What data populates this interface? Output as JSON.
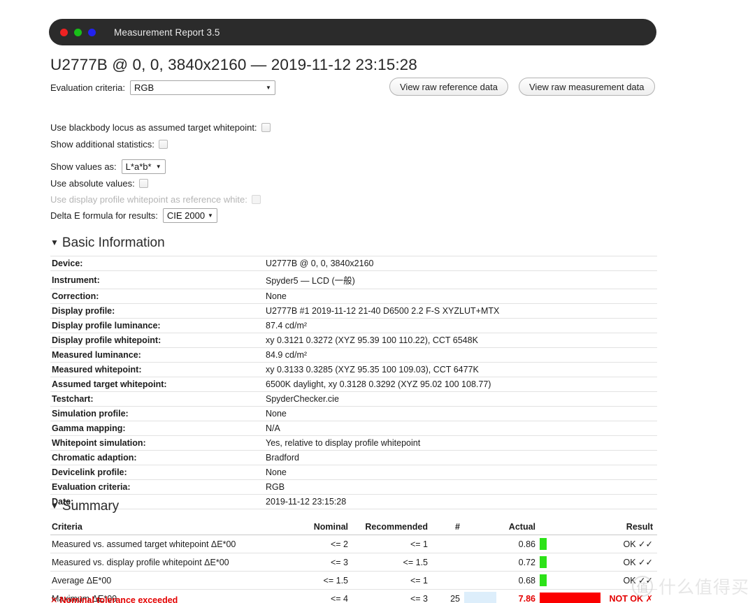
{
  "window": {
    "title": "Measurement Report 3.5",
    "dots": [
      "red",
      "green",
      "blue"
    ],
    "dot_colors": [
      "#ee2222",
      "#18c018",
      "#2222ee"
    ]
  },
  "page_title": "U2777B @ 0, 0, 3840x2160 — 2019-11-12 23:15:28",
  "controls": {
    "evaluation_criteria_label": "Evaluation criteria:",
    "evaluation_criteria_value": "RGB",
    "evaluation_criteria_options": [
      "RGB"
    ],
    "view_raw_reference_button": "View raw reference data",
    "view_raw_measurement_button": "View raw measurement data",
    "blackbody_label": "Use blackbody locus as assumed target whitepoint:",
    "blackbody_checked": false,
    "additional_stats_label": "Show additional statistics:",
    "additional_stats_checked": false,
    "show_values_as_label": "Show values as:",
    "show_values_as_value": "L*a*b*",
    "show_values_as_options": [
      "L*a*b*"
    ],
    "absolute_values_label": "Use absolute values:",
    "absolute_values_checked": false,
    "profile_whitepoint_label": "Use display profile whitepoint as reference white:",
    "profile_whitepoint_checked": false,
    "profile_whitepoint_disabled": true,
    "delta_e_label": "Delta E formula for results:",
    "delta_e_value": "CIE 2000",
    "delta_e_options": [
      "CIE 2000"
    ]
  },
  "basic_information": {
    "heading": "Basic Information",
    "rows": [
      {
        "key": "Device:",
        "value": "U2777B @ 0, 0, 3840x2160"
      },
      {
        "key": "Instrument:",
        "value": "Spyder5 — LCD (一般)"
      },
      {
        "key": "Correction:",
        "value": "None"
      },
      {
        "key": "Display profile:",
        "value": "U2777B #1 2019-11-12 21-40 D6500 2.2 F-S XYZLUT+MTX"
      },
      {
        "key": "Display profile luminance:",
        "value": "87.4 cd/m²"
      },
      {
        "key": "Display profile whitepoint:",
        "value": "xy 0.3121 0.3272 (XYZ 95.39 100 110.22), CCT 6548K"
      },
      {
        "key": "Measured luminance:",
        "value": "84.9 cd/m²"
      },
      {
        "key": "Measured whitepoint:",
        "value": "xy 0.3133 0.3285 (XYZ 95.35 100 109.03), CCT 6477K"
      },
      {
        "key": "Assumed target whitepoint:",
        "value": "6500K daylight, xy 0.3128 0.3292 (XYZ 95.02 100 108.77)"
      },
      {
        "key": "Testchart:",
        "value": "SpyderChecker.cie"
      },
      {
        "key": "Simulation profile:",
        "value": "None"
      },
      {
        "key": "Gamma mapping:",
        "value": "N/A"
      },
      {
        "key": "Whitepoint simulation:",
        "value": "Yes, relative to display profile whitepoint"
      },
      {
        "key": "Chromatic adaption:",
        "value": "Bradford"
      },
      {
        "key": "Devicelink profile:",
        "value": "None"
      },
      {
        "key": "Evaluation criteria:",
        "value": "RGB"
      },
      {
        "key": "Date:",
        "value": "2019-11-12 23:15:28"
      }
    ]
  },
  "summary": {
    "heading": "Summary",
    "columns": [
      "Criteria",
      "Nominal",
      "Recommended",
      "#",
      "",
      "Actual",
      "",
      "Result"
    ],
    "rows": [
      {
        "criteria": "Measured vs. assumed target whitepoint ΔE*00",
        "nominal": "<= 2",
        "recommended": "<= 1",
        "count": "",
        "actual": "0.86",
        "bar_pct": 11,
        "bar_color": "#2ce218",
        "result": "OK ✓✓",
        "status": "ok"
      },
      {
        "criteria": "Measured vs. display profile whitepoint ΔE*00",
        "nominal": "<= 3",
        "recommended": "<= 1.5",
        "count": "",
        "actual": "0.72",
        "bar_pct": 11,
        "bar_color": "#2ce218",
        "result": "OK ✓✓",
        "status": "ok"
      },
      {
        "criteria": "Average ΔE*00",
        "nominal": "<= 1.5",
        "recommended": "<= 1",
        "count": "",
        "actual": "0.68",
        "bar_pct": 11,
        "bar_color": "#2ce218",
        "result": "OK ✓✓",
        "status": "ok"
      },
      {
        "criteria": "Maximum ΔE*00",
        "nominal": "<= 4",
        "recommended": "<= 3",
        "count": "25",
        "actual": "7.86",
        "bar_pct": 95,
        "bar_color": "#fb0000",
        "result": "NOT OK ✗",
        "status": "not-ok"
      }
    ],
    "note": "Nominal tolerance exceeded",
    "note_mark": "✕"
  },
  "watermark": {
    "logo_char": "值",
    "text": "什么值得买"
  },
  "colors": {
    "ok_green": "#2e9b2e",
    "bar_green": "#2ce218",
    "bad_red": "#e40000",
    "bar_red": "#fb0000",
    "blue_cell": "#ddeefb",
    "titlebar": "#2b2b2b"
  }
}
